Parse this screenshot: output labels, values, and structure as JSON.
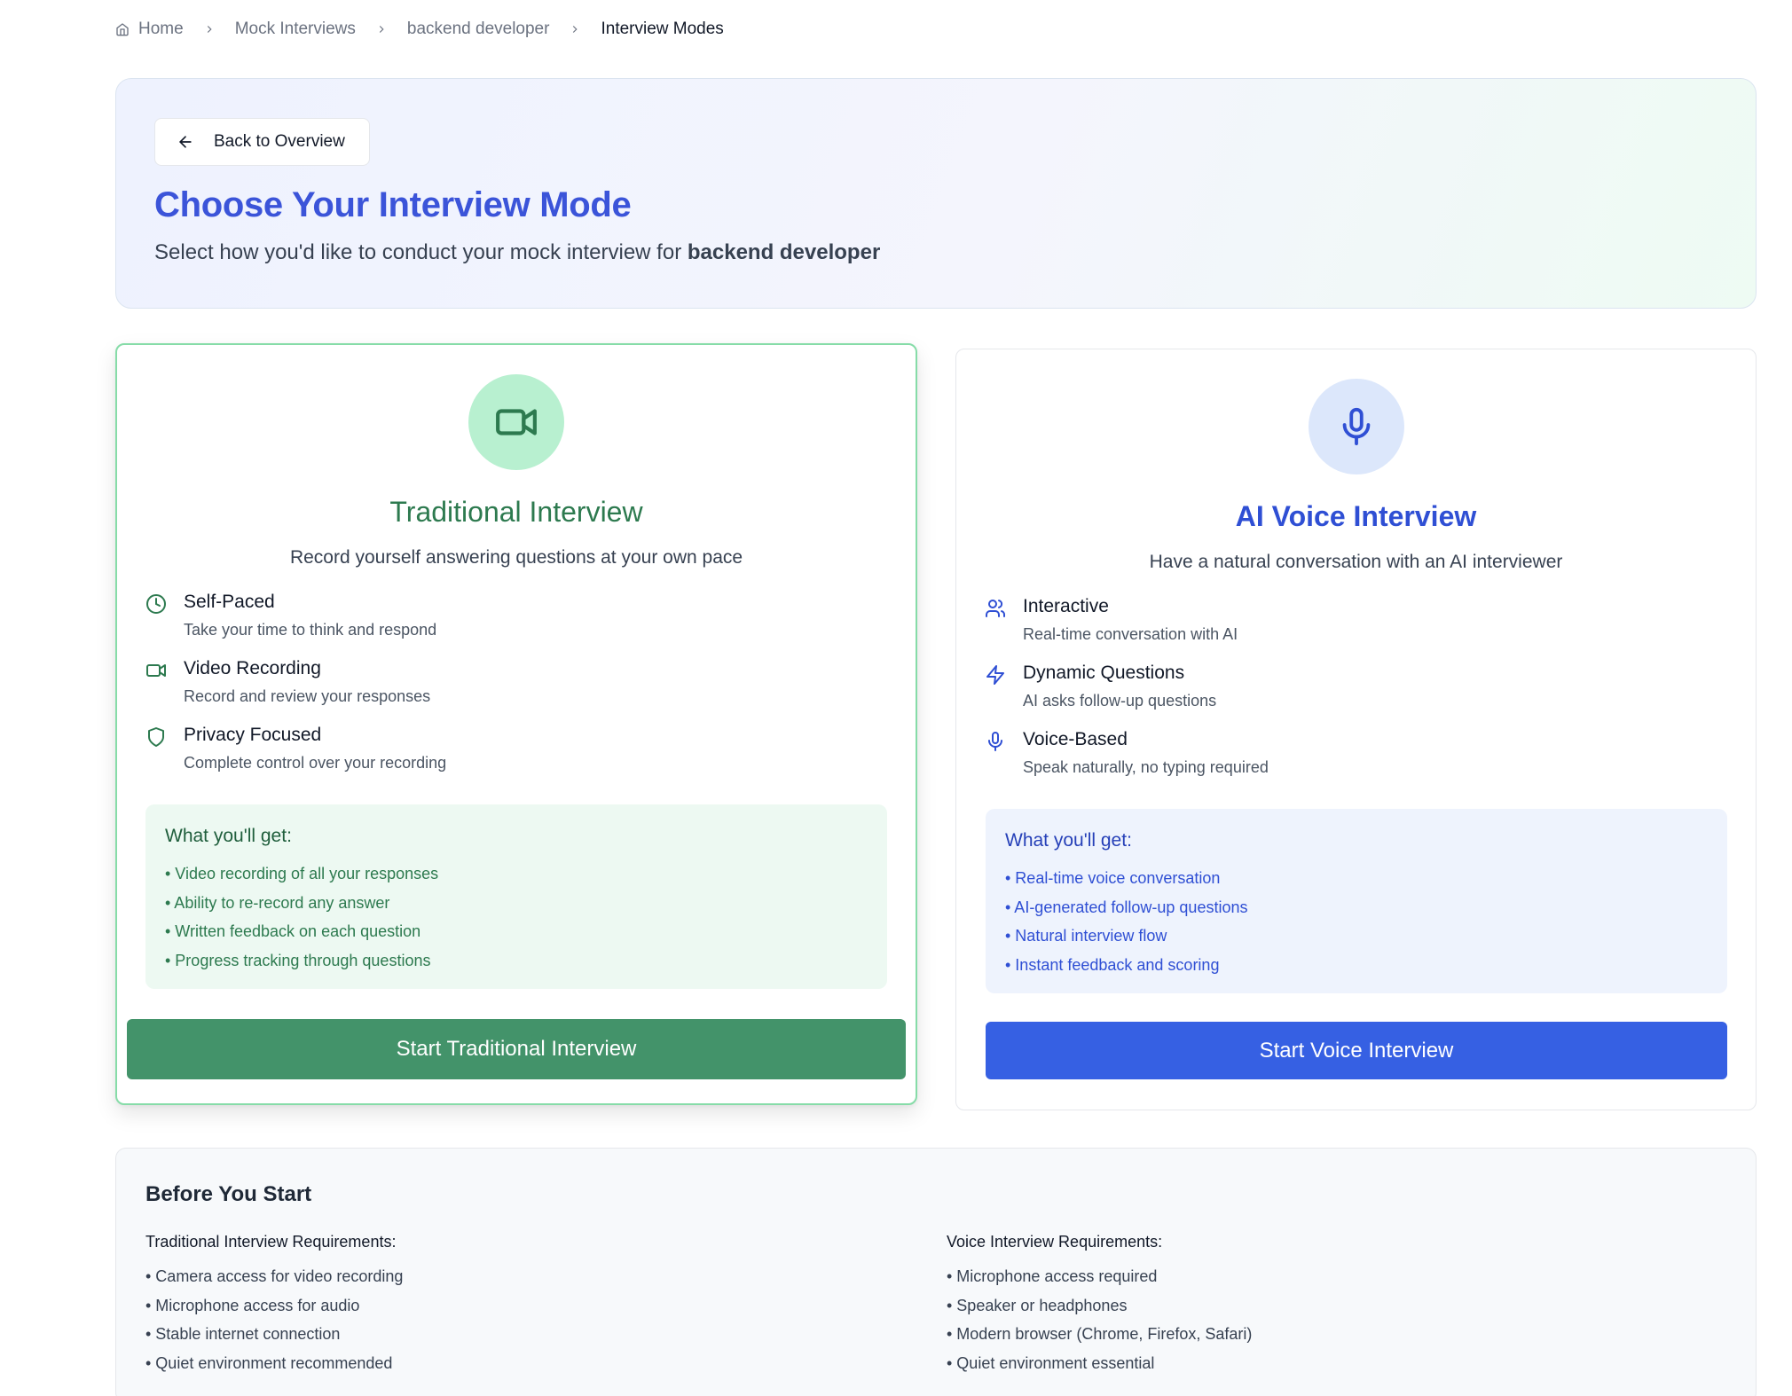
{
  "breadcrumb": {
    "items": [
      "Home",
      "Mock Interviews",
      "backend developer",
      "Interview Modes"
    ]
  },
  "hero": {
    "back_label": "Back to Overview",
    "title": "Choose Your Interview Mode",
    "subtitle_prefix": "Select how you'd like to conduct your mock interview for ",
    "subtitle_role": "backend developer"
  },
  "traditional": {
    "icon": "video-camera-icon",
    "title": "Traditional Interview",
    "description": "Record yourself answering questions at your own pace",
    "features": [
      {
        "icon": "clock-icon",
        "title": "Self-Paced",
        "desc": "Take your time to think and respond"
      },
      {
        "icon": "video-icon",
        "title": "Video Recording",
        "desc": "Record and review your responses"
      },
      {
        "icon": "shield-icon",
        "title": "Privacy Focused",
        "desc": "Complete control over your recording"
      }
    ],
    "benefits_title": "What you'll get:",
    "benefits": [
      "• Video recording of all your responses",
      "• Ability to re-record any answer",
      "• Written feedback on each question",
      "• Progress tracking through questions"
    ],
    "button": "Start Traditional Interview",
    "accent": "#43936a"
  },
  "voice": {
    "icon": "microphone-icon",
    "title": "AI Voice Interview",
    "description": "Have a natural conversation with an AI interviewer",
    "features": [
      {
        "icon": "users-icon",
        "title": "Interactive",
        "desc": "Real-time conversation with AI"
      },
      {
        "icon": "lightning-icon",
        "title": "Dynamic Questions",
        "desc": "AI asks follow-up questions"
      },
      {
        "icon": "microphone-icon",
        "title": "Voice-Based",
        "desc": "Speak naturally, no typing required"
      }
    ],
    "benefits_title": "What you'll get:",
    "benefits": [
      "• Real-time voice conversation",
      "• AI-generated follow-up questions",
      "• Natural interview flow",
      "• Instant feedback and scoring"
    ],
    "button": "Start Voice Interview",
    "accent": "#3660e3"
  },
  "before": {
    "title": "Before You Start",
    "traditional_head": "Traditional Interview Requirements:",
    "traditional_items": [
      "• Camera access for video recording",
      "• Microphone access for audio",
      "• Stable internet connection",
      "• Quiet environment recommended"
    ],
    "voice_head": "Voice Interview Requirements:",
    "voice_items": [
      "• Microphone access required",
      "• Speaker or headphones",
      "• Modern browser (Chrome, Firefox, Safari)",
      "• Quiet environment essential"
    ]
  }
}
